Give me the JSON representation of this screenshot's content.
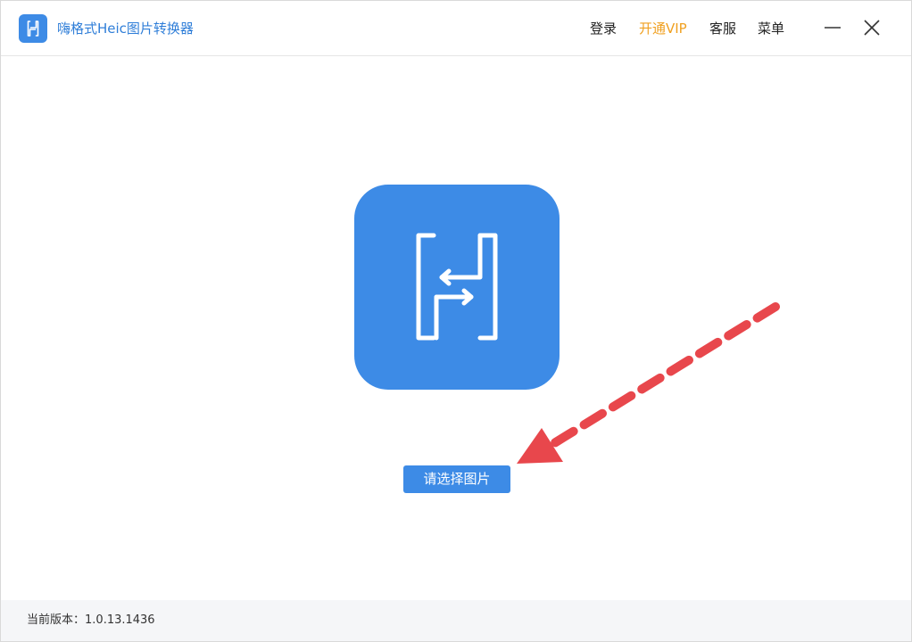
{
  "app": {
    "title": "嗨格式Heic图片转换器"
  },
  "nav": {
    "login": "登录",
    "vip": "开通VIP",
    "support": "客服",
    "menu": "菜单"
  },
  "window_controls": {
    "minimize_icon": "minimize-icon",
    "close_icon": "close-icon"
  },
  "main": {
    "select_button": "请选择图片"
  },
  "footer": {
    "version_label": "当前版本：",
    "version": "1.0.13.1436"
  },
  "colors": {
    "brand": "#3d8be6",
    "title": "#2f7ed8",
    "vip": "#f0a020",
    "annotation_arrow": "#e8474c"
  }
}
